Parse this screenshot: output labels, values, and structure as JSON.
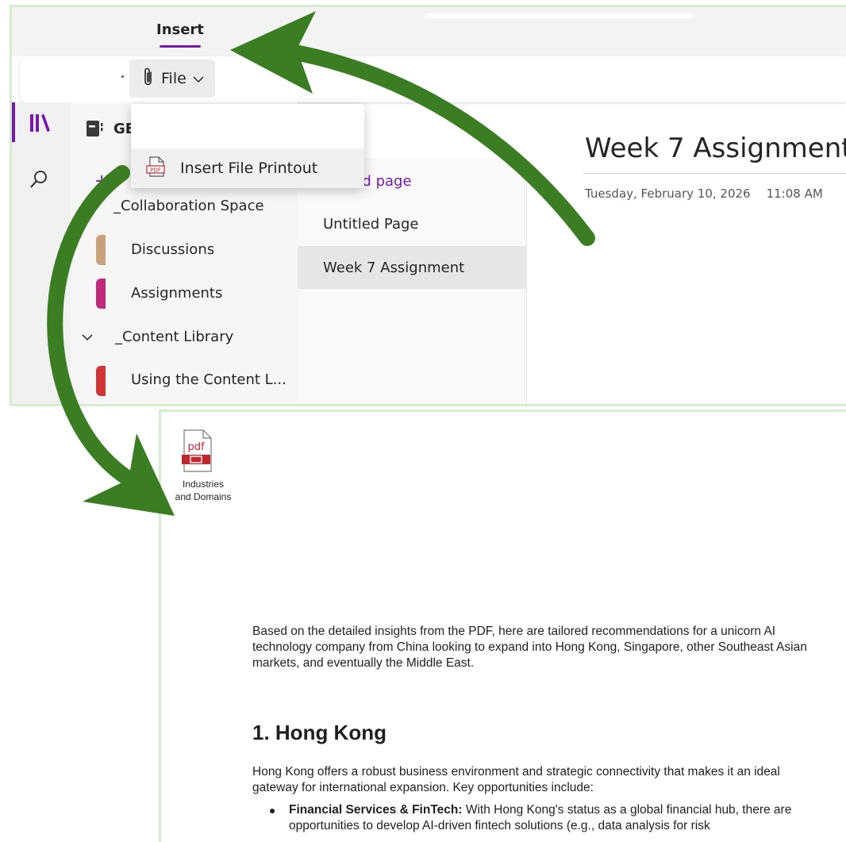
{
  "ribbon": {
    "active_tab": "Insert"
  },
  "toolbar": {
    "file_label": "File"
  },
  "file_menu": {
    "items": [
      {
        "label": "Insert File Printout",
        "icon": "pdf-file-icon"
      }
    ]
  },
  "rail": {
    "icons": [
      "notebooks-icon",
      "search-icon"
    ]
  },
  "notebook": {
    "title": "GE"
  },
  "sections": [
    {
      "label": "_Collaboration Space",
      "type": "group",
      "expanded": true
    },
    {
      "label": "Discussions",
      "type": "section",
      "color": "#c8a27c"
    },
    {
      "label": "Assignments",
      "type": "section",
      "color": "#c0297c"
    },
    {
      "label": "_Content Library",
      "type": "group",
      "expanded": true
    },
    {
      "label": "Using the Content L...",
      "type": "section",
      "color": "#d13438"
    }
  ],
  "pages": {
    "add_label": "dd page",
    "items": [
      {
        "label": "Untitled Page",
        "selected": false
      },
      {
        "label": "Week 7 Assignment",
        "selected": true
      }
    ]
  },
  "page": {
    "title": "Week 7 Assignment",
    "date": "Tuesday, February 10, 2026",
    "time": "11:08 AM"
  },
  "attachment": {
    "caption_line1": "Industries",
    "caption_line2": "and Domains",
    "icon_text": "pdf"
  },
  "document": {
    "intro": "Based on the detailed insights from the PDF, here are tailored recommendations for a unicorn AI technology company from China looking to expand into Hong Kong, Singapore, other Southeast Asian markets, and eventually the Middle East.",
    "heading": "1. Hong Kong",
    "paragraph": "Hong Kong offers a robust business environment and strategic connectivity that makes it an ideal gateway for international expansion. Key opportunities include:",
    "bullet_title": "Financial Services & FinTech:",
    "bullet_text": " With Hong Kong's status as a global financial hub, there are opportunities to develop AI-driven fintech solutions (e.g., data analysis for risk"
  },
  "colors": {
    "accent": "#7719aa",
    "arrow": "#3a7d22",
    "panel_border": "#d6ecd1"
  }
}
